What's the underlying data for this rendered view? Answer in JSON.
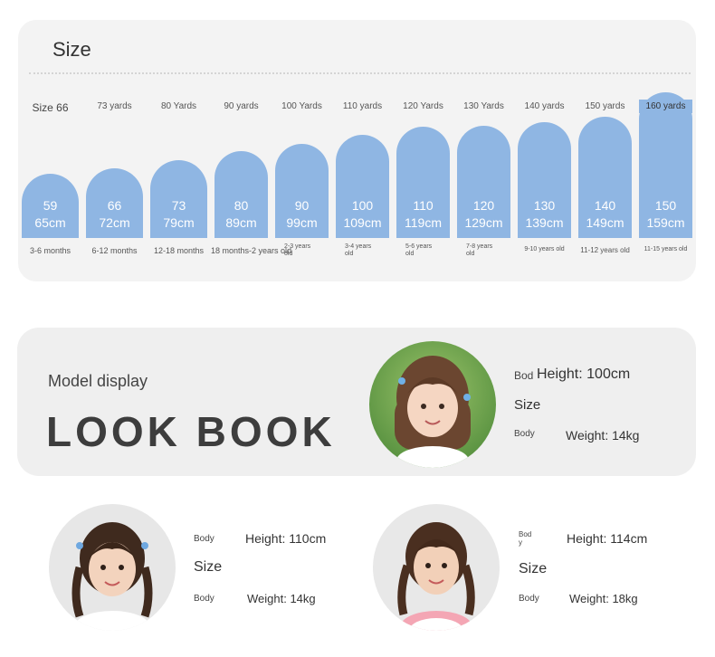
{
  "size_chart": {
    "title": "Size",
    "columns": [
      {
        "yard": "Size 66",
        "size": "59",
        "height": "65cm",
        "age": "3-6 months"
      },
      {
        "yard": "73 yards",
        "size": "66",
        "height": "72cm",
        "age": "6-12 months"
      },
      {
        "yard": "80 Yards",
        "size": "73",
        "height": "79cm",
        "age": "12-18 months"
      },
      {
        "yard": "90 yards",
        "size": "80",
        "height": "89cm",
        "age": "18 months-2 years old"
      },
      {
        "yard": "100 Yards",
        "size": "90",
        "height": "99cm",
        "age": "2-3 years old"
      },
      {
        "yard": "110 yards",
        "size": "100",
        "height": "109cm",
        "age": "3-4 years old"
      },
      {
        "yard": "120 Yards",
        "size": "110",
        "height": "119cm",
        "age": "5-6 years old"
      },
      {
        "yard": "130 Yards",
        "size": "120",
        "height": "129cm",
        "age": "7-8 years old"
      },
      {
        "yard": "140 yards",
        "size": "130",
        "height": "139cm",
        "age": "9-10 years old"
      },
      {
        "yard": "150 yards",
        "size": "140",
        "height": "149cm",
        "age": "11-12 years old"
      },
      {
        "yard": "160 yards",
        "size": "150",
        "height": "159cm",
        "age": "11-15 years old"
      }
    ]
  },
  "lookbook": {
    "subtitle": "Model display",
    "title": "LOOK BOOK"
  },
  "models": [
    {
      "body1": "Bod",
      "height": "Height: 100cm",
      "size_label": "Size",
      "body2": "Body",
      "weight": "Weight: 14kg"
    },
    {
      "body1": "Body",
      "height": "Height: 110cm",
      "size_label": "Size",
      "body2": "Body",
      "weight": "Weight: 14kg"
    },
    {
      "body1": "Bod\ny",
      "height": "Height: 114cm",
      "size_label": "Size",
      "body2": "Body",
      "weight": "Weight: 18kg"
    }
  ],
  "colors": {
    "bar": "#8fb6e3",
    "card": "#f3f3f3",
    "lookbook_bg": "#efefef"
  }
}
